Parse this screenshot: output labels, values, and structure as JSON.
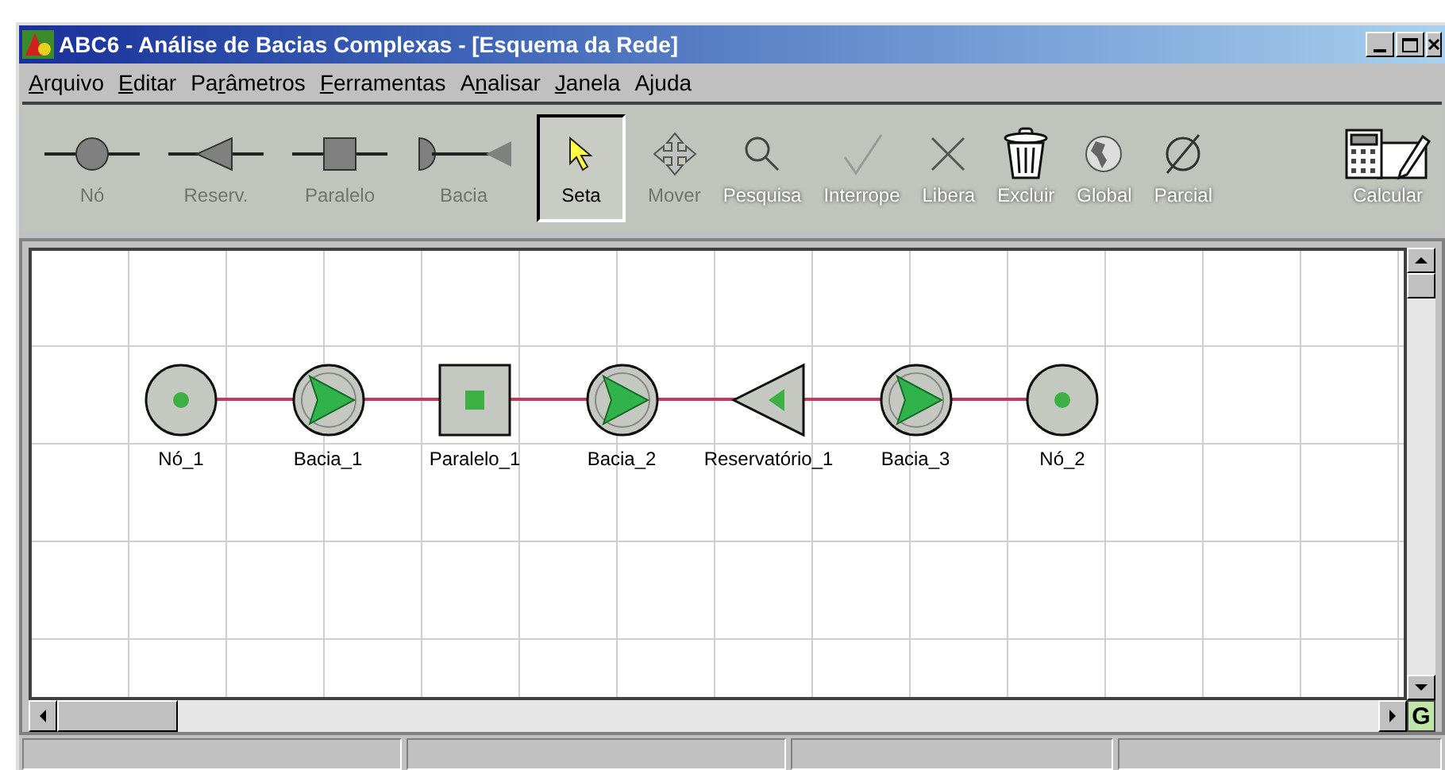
{
  "window": {
    "title": "ABC6 - Análise de Bacias Complexas - [Esquema da Rede]"
  },
  "menu": [
    {
      "access_key": "A",
      "after": "rquivo"
    },
    {
      "access_key": "E",
      "after": "ditar"
    },
    {
      "before": "Pa",
      "access_key": "r",
      "after": "âmetros"
    },
    {
      "access_key": "F",
      "after": "erramentas"
    },
    {
      "before": "A",
      "access_key": "n",
      "after": "alisar"
    },
    {
      "access_key": "J",
      "after": "anela"
    },
    {
      "before": "A",
      "access_key": "j",
      "after": "uda"
    }
  ],
  "toolbar": [
    {
      "label": "Nó",
      "kind": "node",
      "selected": false,
      "highlighted": false
    },
    {
      "label": "Reserv.",
      "kind": "reservoir",
      "selected": false,
      "highlighted": false
    },
    {
      "label": "Paralelo",
      "kind": "parallel",
      "selected": false,
      "highlighted": false
    },
    {
      "label": "Bacia",
      "kind": "basin",
      "selected": false,
      "highlighted": false
    },
    {
      "label": "Seta",
      "kind": "arrow",
      "selected": true,
      "highlighted": false
    },
    {
      "label": "Mover",
      "kind": "move",
      "selected": false,
      "highlighted": false
    },
    {
      "label": "Pesquisa",
      "kind": "search",
      "selected": false,
      "highlighted": true
    },
    {
      "label": "Interrope",
      "kind": "check",
      "selected": false,
      "highlighted": true
    },
    {
      "label": "Libera",
      "kind": "cross",
      "selected": false,
      "highlighted": true
    },
    {
      "label": "Excluir",
      "kind": "trash",
      "selected": false,
      "highlighted": true
    },
    {
      "label": "Global",
      "kind": "globe",
      "selected": false,
      "highlighted": true
    },
    {
      "label": "Parcial",
      "kind": "empty",
      "selected": false,
      "highlighted": true
    },
    {
      "label": "Calcular",
      "kind": "calculator",
      "selected": false,
      "highlighted": true
    }
  ],
  "diagram": {
    "nodes": [
      {
        "label": "Nó_1",
        "kind": "node"
      },
      {
        "label": "Bacia_1",
        "kind": "basin"
      },
      {
        "label": "Paralelo_1",
        "kind": "parallel"
      },
      {
        "label": "Bacia_2",
        "kind": "basin"
      },
      {
        "label": "Reservatório_1",
        "kind": "reservoir"
      },
      {
        "label": "Bacia_3",
        "kind": "basin"
      },
      {
        "label": "Nó_2",
        "kind": "node"
      }
    ]
  },
  "corner_button": {
    "label": "G"
  }
}
